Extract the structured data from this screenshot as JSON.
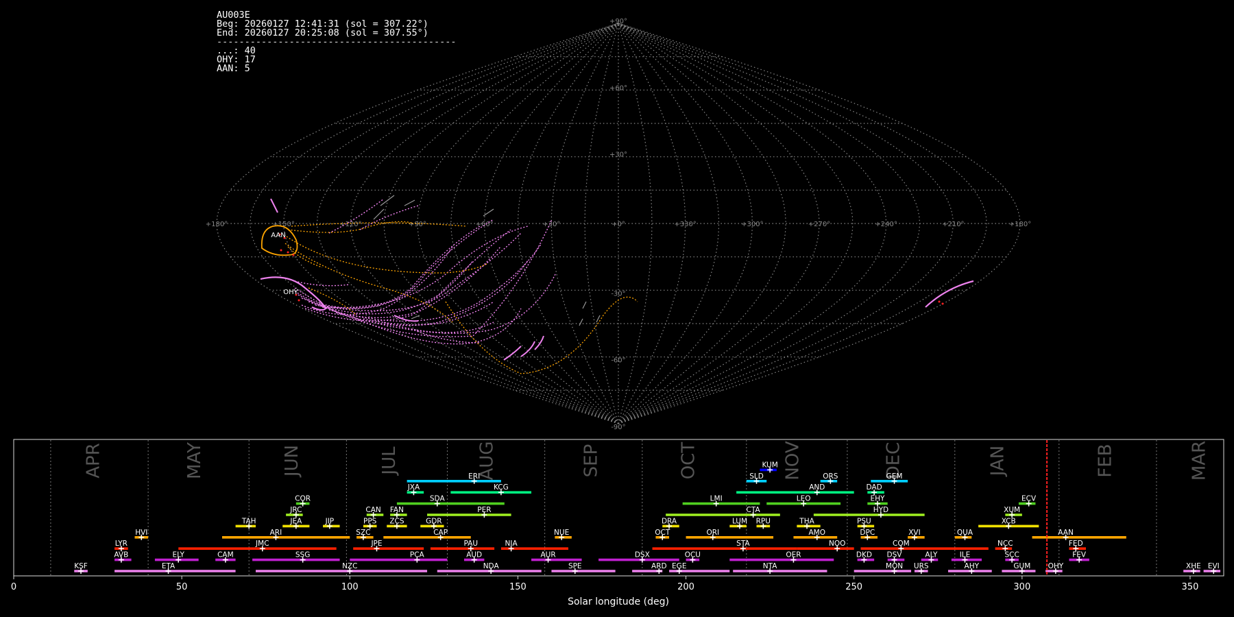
{
  "info": {
    "station": "AU003E",
    "begin": "Beg: 20260127 12:41:31 (sol = 307.22°)",
    "end": "End: 20260127 20:25:08 (sol = 307.55°)",
    "rule": "-------------------------------------------",
    "counts": [
      {
        "label": "...",
        "value": 40
      },
      {
        "label": "OHY",
        "value": 17
      },
      {
        "label": "AAN",
        "value": 5
      }
    ]
  },
  "skymap": {
    "projection": "sinusoidal",
    "lat_labels": [
      "+90°",
      "+60°",
      "+30°",
      "-30°",
      "-60°",
      "-90°"
    ],
    "lon_labels": [
      "+180°",
      "+150°",
      "+120°",
      "+90°",
      "+60°",
      "+30°",
      "+0°",
      "+330°",
      "+300°",
      "+270°",
      "+240°",
      "+210°",
      "+180°"
    ],
    "radiants": [
      {
        "name": "AAN",
        "lon": 156,
        "lat": -4
      },
      {
        "name": "OHY",
        "lon": 154,
        "lat": -29
      }
    ],
    "colors": {
      "sporadic": "#ee82ee",
      "AAN": "#ffa500",
      "OHY": "#ff69b4",
      "grid": "#888888"
    }
  },
  "chart_data": {
    "type": "bar",
    "subtype": "meteor shower activity timeline",
    "xlabel": "Solar longitude (deg)",
    "xlim": [
      0,
      360
    ],
    "xticks": [
      0,
      50,
      100,
      150,
      200,
      250,
      300,
      350
    ],
    "current_sol": 307.4,
    "months": [
      {
        "name": "APR",
        "start": 11,
        "mid": 24
      },
      {
        "name": "MAY",
        "start": 40,
        "mid": 54
      },
      {
        "name": "JUN",
        "start": 70,
        "mid": 83
      },
      {
        "name": "JUL",
        "start": 99,
        "mid": 112
      },
      {
        "name": "AUG",
        "start": 129,
        "mid": 141
      },
      {
        "name": "SEP",
        "start": 158,
        "mid": 172
      },
      {
        "name": "OCT",
        "start": 187,
        "mid": 201
      },
      {
        "name": "NOV",
        "start": 218,
        "mid": 232
      },
      {
        "name": "DEC",
        "start": 248,
        "mid": 262
      },
      {
        "name": "JAN",
        "start": 280,
        "mid": 293
      },
      {
        "name": "FEB",
        "start": 311,
        "mid": 325
      },
      {
        "name": "MAR",
        "start": 340,
        "mid": 353
      }
    ],
    "showers": [
      {
        "code": "KUM",
        "start": 222,
        "end": 227,
        "peak": 225,
        "row": 9,
        "color": "#0000ff"
      },
      {
        "code": "ERI",
        "start": 117,
        "end": 145,
        "peak": 137,
        "row": 8,
        "color": "#00d0ff"
      },
      {
        "code": "SLD",
        "start": 218,
        "end": 224,
        "peak": 221,
        "row": 8,
        "color": "#00d0ff"
      },
      {
        "code": "ORS",
        "start": 240,
        "end": 245,
        "peak": 243,
        "row": 8,
        "color": "#00d0ff"
      },
      {
        "code": "GEM",
        "start": 255,
        "end": 266,
        "peak": 262,
        "row": 8,
        "color": "#00d0ff"
      },
      {
        "code": "JXA",
        "start": 117,
        "end": 122,
        "peak": 119,
        "row": 7,
        "color": "#00ee80"
      },
      {
        "code": "KCG",
        "start": 130,
        "end": 154,
        "peak": 145,
        "row": 7,
        "color": "#00ee80"
      },
      {
        "code": "AND",
        "start": 215,
        "end": 250,
        "peak": 239,
        "row": 7,
        "color": "#00ee80"
      },
      {
        "code": "DAD",
        "start": 254,
        "end": 259,
        "peak": 256,
        "row": 7,
        "color": "#00ee80"
      },
      {
        "code": "COR",
        "start": 84,
        "end": 88,
        "peak": 86,
        "row": 6,
        "color": "#50d020"
      },
      {
        "code": "SDA",
        "start": 114,
        "end": 146,
        "peak": 126,
        "row": 6,
        "color": "#50d020"
      },
      {
        "code": "LMI",
        "start": 199,
        "end": 222,
        "peak": 209,
        "row": 6,
        "color": "#50d020"
      },
      {
        "code": "LEO",
        "start": 224,
        "end": 246,
        "peak": 235,
        "row": 6,
        "color": "#50d020"
      },
      {
        "code": "EHY",
        "start": 254,
        "end": 260,
        "peak": 257,
        "row": 6,
        "color": "#50d020"
      },
      {
        "code": "ECV",
        "start": 299,
        "end": 304,
        "peak": 302,
        "row": 6,
        "color": "#50d020"
      },
      {
        "code": "JRC",
        "start": 81,
        "end": 86,
        "peak": 84,
        "row": 5,
        "color": "#a0f020"
      },
      {
        "code": "CAN",
        "start": 105,
        "end": 110,
        "peak": 107,
        "row": 5,
        "color": "#a0f020"
      },
      {
        "code": "FAN",
        "start": 112,
        "end": 117,
        "peak": 114,
        "row": 5,
        "color": "#a0f020"
      },
      {
        "code": "PER",
        "start": 123,
        "end": 148,
        "peak": 140,
        "row": 5,
        "color": "#a0f020"
      },
      {
        "code": "CTA",
        "start": 194,
        "end": 228,
        "peak": 220,
        "row": 5,
        "color": "#a0f020"
      },
      {
        "code": "HYD",
        "start": 238,
        "end": 271,
        "peak": 258,
        "row": 5,
        "color": "#a0f020"
      },
      {
        "code": "XUM",
        "start": 295,
        "end": 300,
        "peak": 297,
        "row": 5,
        "color": "#a0f020"
      },
      {
        "code": "TAH",
        "start": 66,
        "end": 72,
        "peak": 70,
        "row": 4,
        "color": "#f0e000"
      },
      {
        "code": "JEA",
        "start": 80,
        "end": 88,
        "peak": 84,
        "row": 4,
        "color": "#f0e000"
      },
      {
        "code": "JIP",
        "start": 92,
        "end": 97,
        "peak": 94,
        "row": 4,
        "color": "#f0e000"
      },
      {
        "code": "PPS",
        "start": 104,
        "end": 108,
        "peak": 106,
        "row": 4,
        "color": "#f0e000"
      },
      {
        "code": "ZCS",
        "start": 111,
        "end": 117,
        "peak": 114,
        "row": 4,
        "color": "#f0e000"
      },
      {
        "code": "GDR",
        "start": 121,
        "end": 128,
        "peak": 125,
        "row": 4,
        "color": "#f0e000"
      },
      {
        "code": "DRA",
        "start": 193,
        "end": 198,
        "peak": 195,
        "row": 4,
        "color": "#f0e000"
      },
      {
        "code": "LUM",
        "start": 213,
        "end": 218,
        "peak": 216,
        "row": 4,
        "color": "#f0e000"
      },
      {
        "code": "RPU",
        "start": 221,
        "end": 225,
        "peak": 223,
        "row": 4,
        "color": "#f0e000"
      },
      {
        "code": "THA",
        "start": 233,
        "end": 240,
        "peak": 236,
        "row": 4,
        "color": "#f0e000"
      },
      {
        "code": "PSU",
        "start": 251,
        "end": 256,
        "peak": 253,
        "row": 4,
        "color": "#f0e000"
      },
      {
        "code": "XCB",
        "start": 287,
        "end": 305,
        "peak": 296,
        "row": 4,
        "color": "#f0e000"
      },
      {
        "code": "HVI",
        "start": 36,
        "end": 40,
        "peak": 38,
        "row": 3,
        "color": "#ffa500"
      },
      {
        "code": "ARI",
        "start": 62,
        "end": 100,
        "peak": 78,
        "row": 3,
        "color": "#ffa500"
      },
      {
        "code": "SZC",
        "start": 102,
        "end": 107,
        "peak": 104,
        "row": 3,
        "color": "#ffa500"
      },
      {
        "code": "CAP",
        "start": 110,
        "end": 136,
        "peak": 127,
        "row": 3,
        "color": "#ffa500"
      },
      {
        "code": "NUE",
        "start": 161,
        "end": 166,
        "peak": 163,
        "row": 3,
        "color": "#ffa500"
      },
      {
        "code": "OCT",
        "start": 191,
        "end": 195,
        "peak": 193,
        "row": 3,
        "color": "#ffa500"
      },
      {
        "code": "ORI",
        "start": 200,
        "end": 226,
        "peak": 208,
        "row": 3,
        "color": "#ffa500"
      },
      {
        "code": "AMO",
        "start": 232,
        "end": 245,
        "peak": 239,
        "row": 3,
        "color": "#ffa500"
      },
      {
        "code": "DPC",
        "start": 252,
        "end": 257,
        "peak": 254,
        "row": 3,
        "color": "#ffa500"
      },
      {
        "code": "XVI",
        "start": 266,
        "end": 271,
        "peak": 268,
        "row": 3,
        "color": "#ffa500"
      },
      {
        "code": "QUA",
        "start": 280,
        "end": 285,
        "peak": 283,
        "row": 3,
        "color": "#ffa500"
      },
      {
        "code": "AAN",
        "start": 303,
        "end": 331,
        "peak": 313,
        "row": 3,
        "color": "#ffa500"
      },
      {
        "code": "LYR",
        "start": 30,
        "end": 34,
        "peak": 32,
        "row": 2,
        "color": "#ff2000"
      },
      {
        "code": "JMC",
        "start": 49,
        "end": 96,
        "peak": 74,
        "row": 2,
        "color": "#ff2000"
      },
      {
        "code": "JPE",
        "start": 101,
        "end": 122,
        "peak": 108,
        "row": 2,
        "color": "#ff2000"
      },
      {
        "code": "PAU",
        "start": 124,
        "end": 143,
        "peak": 136,
        "row": 2,
        "color": "#ff2000"
      },
      {
        "code": "NIA",
        "start": 145,
        "end": 165,
        "peak": 148,
        "row": 2,
        "color": "#ff2000"
      },
      {
        "code": "STA",
        "start": 190,
        "end": 233,
        "peak": 217,
        "row": 2,
        "color": "#ff2000"
      },
      {
        "code": "NOO",
        "start": 233,
        "end": 250,
        "peak": 245,
        "row": 2,
        "color": "#ff2000"
      },
      {
        "code": "COM",
        "start": 252,
        "end": 290,
        "peak": 264,
        "row": 2,
        "color": "#ff2000"
      },
      {
        "code": "NCC",
        "start": 292,
        "end": 297,
        "peak": 295,
        "row": 2,
        "color": "#ff2000"
      },
      {
        "code": "FED",
        "start": 314,
        "end": 319,
        "peak": 316,
        "row": 2,
        "color": "#ff2000"
      },
      {
        "code": "AVB",
        "start": 30,
        "end": 35,
        "peak": 32,
        "row": 1,
        "color": "#c020d0"
      },
      {
        "code": "ELY",
        "start": 42,
        "end": 55,
        "peak": 49,
        "row": 1,
        "color": "#c020d0"
      },
      {
        "code": "CAM",
        "start": 60,
        "end": 66,
        "peak": 63,
        "row": 1,
        "color": "#c020d0"
      },
      {
        "code": "SSG",
        "start": 71,
        "end": 97,
        "peak": 86,
        "row": 1,
        "color": "#c020d0"
      },
      {
        "code": "PCA",
        "start": 100,
        "end": 129,
        "peak": 120,
        "row": 1,
        "color": "#c020d0"
      },
      {
        "code": "AUD",
        "start": 134,
        "end": 140,
        "peak": 137,
        "row": 1,
        "color": "#c020d0"
      },
      {
        "code": "AUR",
        "start": 154,
        "end": 169,
        "peak": 159,
        "row": 1,
        "color": "#c020d0"
      },
      {
        "code": "DSX",
        "start": 174,
        "end": 198,
        "peak": 187,
        "row": 1,
        "color": "#c020d0"
      },
      {
        "code": "OCU",
        "start": 200,
        "end": 204,
        "peak": 202,
        "row": 1,
        "color": "#c020d0"
      },
      {
        "code": "OER",
        "start": 213,
        "end": 244,
        "peak": 232,
        "row": 1,
        "color": "#c020d0"
      },
      {
        "code": "DKD",
        "start": 251,
        "end": 256,
        "peak": 253,
        "row": 1,
        "color": "#c020d0"
      },
      {
        "code": "DSV",
        "start": 260,
        "end": 265,
        "peak": 262,
        "row": 1,
        "color": "#c020d0"
      },
      {
        "code": "ALY",
        "start": 270,
        "end": 275,
        "peak": 273,
        "row": 1,
        "color": "#c020d0"
      },
      {
        "code": "ILE",
        "start": 279,
        "end": 288,
        "peak": 283,
        "row": 1,
        "color": "#c020d0"
      },
      {
        "code": "SCC",
        "start": 295,
        "end": 299,
        "peak": 297,
        "row": 1,
        "color": "#c020d0"
      },
      {
        "code": "FEV",
        "start": 314,
        "end": 320,
        "peak": 317,
        "row": 1,
        "color": "#c020d0"
      },
      {
        "code": "KSF",
        "start": 18,
        "end": 22,
        "peak": 20,
        "row": 0,
        "color": "#ee82ee"
      },
      {
        "code": "ETA",
        "start": 30,
        "end": 66,
        "peak": 46,
        "row": 0,
        "color": "#ee82ee"
      },
      {
        "code": "NZC",
        "start": 72,
        "end": 123,
        "peak": 100,
        "row": 0,
        "color": "#ee82ee"
      },
      {
        "code": "NDA",
        "start": 126,
        "end": 157,
        "peak": 142,
        "row": 0,
        "color": "#ee82ee"
      },
      {
        "code": "SPE",
        "start": 160,
        "end": 179,
        "peak": 167,
        "row": 0,
        "color": "#ee82ee"
      },
      {
        "code": "ARD",
        "start": 184,
        "end": 193,
        "peak": 192,
        "row": 0,
        "color": "#ee82ee"
      },
      {
        "code": "EGE",
        "start": 195,
        "end": 213,
        "peak": 198,
        "row": 0,
        "color": "#ee82ee"
      },
      {
        "code": "NTA",
        "start": 214,
        "end": 242,
        "peak": 225,
        "row": 0,
        "color": "#ee82ee"
      },
      {
        "code": "MON",
        "start": 250,
        "end": 267,
        "peak": 262,
        "row": 0,
        "color": "#ee82ee"
      },
      {
        "code": "URS",
        "start": 268,
        "end": 272,
        "peak": 270,
        "row": 0,
        "color": "#ee82ee"
      },
      {
        "code": "AHY",
        "start": 278,
        "end": 291,
        "peak": 285,
        "row": 0,
        "color": "#ee82ee"
      },
      {
        "code": "GUM",
        "start": 294,
        "end": 304,
        "peak": 300,
        "row": 0,
        "color": "#ee82ee"
      },
      {
        "code": "OHY",
        "start": 307,
        "end": 312,
        "peak": 310,
        "row": 0,
        "color": "#ee82ee"
      },
      {
        "code": "XHE",
        "start": 348,
        "end": 353,
        "peak": 351,
        "row": 0,
        "color": "#ee82ee"
      },
      {
        "code": "EVI",
        "start": 354,
        "end": 359,
        "peak": 357,
        "row": 0,
        "color": "#ee82ee"
      }
    ]
  }
}
